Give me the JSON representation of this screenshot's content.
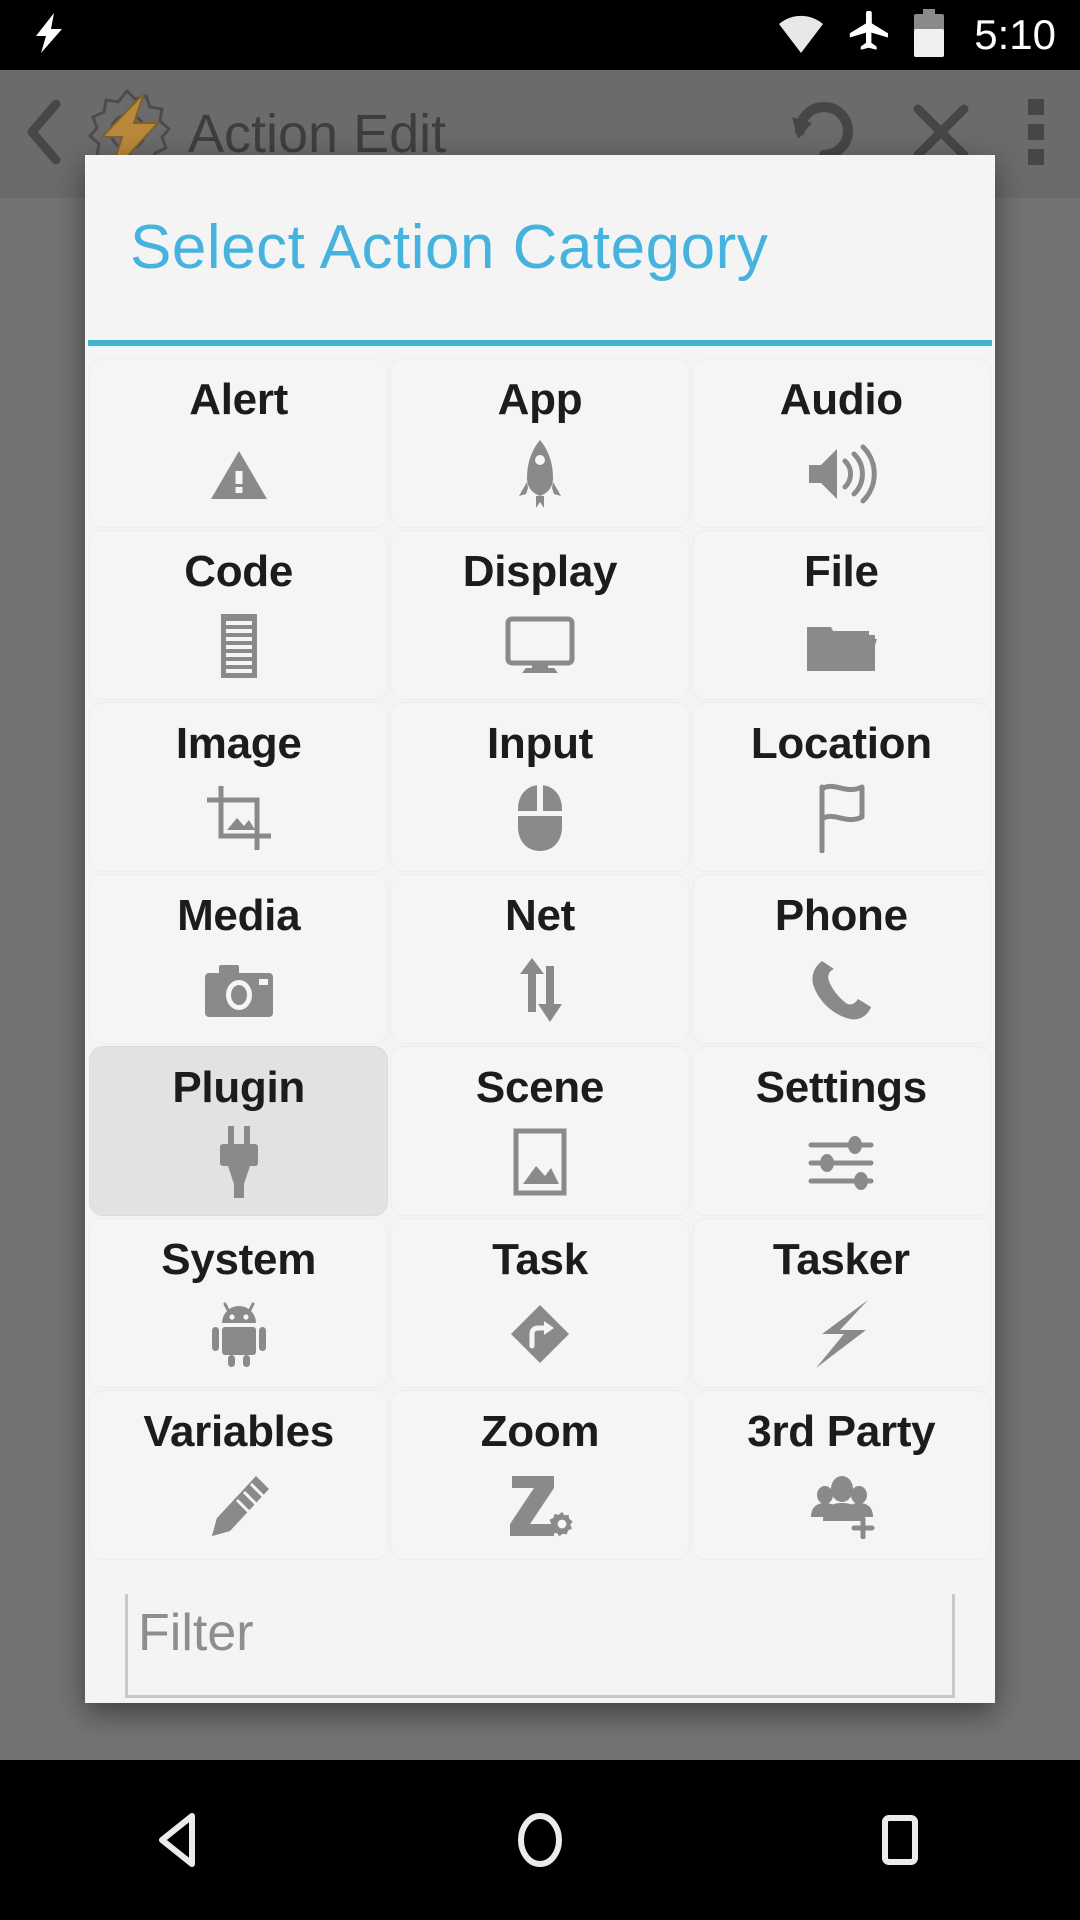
{
  "status_bar": {
    "time": "5:10",
    "icons": [
      "wifi-icon",
      "airplane-mode-icon",
      "battery-icon"
    ]
  },
  "background_app": {
    "title": "Action Edit",
    "back_icon": "back-chevron-icon",
    "logo_icon": "tasker-gear-logo-icon",
    "actions": [
      "undo-icon",
      "close-x-icon",
      "overflow-menu-icon"
    ]
  },
  "dialog": {
    "title": "Select Action Category",
    "accent_color": "#45b3dd",
    "divider_color": "#45b2cf",
    "background_color": "#f4f4f4",
    "selected_cell_color": "#e2e2e2",
    "categories": [
      {
        "label": "Alert",
        "icon": "warning-triangle-icon",
        "selected": false
      },
      {
        "label": "App",
        "icon": "rocket-icon",
        "selected": false
      },
      {
        "label": "Audio",
        "icon": "speaker-volume-icon",
        "selected": false
      },
      {
        "label": "Code",
        "icon": "lined-document-icon",
        "selected": false
      },
      {
        "label": "Display",
        "icon": "monitor-icon",
        "selected": false
      },
      {
        "label": "File",
        "icon": "folder-icon",
        "selected": false
      },
      {
        "label": "Image",
        "icon": "crop-image-icon",
        "selected": false
      },
      {
        "label": "Input",
        "icon": "mouse-icon",
        "selected": false
      },
      {
        "label": "Location",
        "icon": "flag-icon",
        "selected": false
      },
      {
        "label": "Media",
        "icon": "camera-icon",
        "selected": false
      },
      {
        "label": "Net",
        "icon": "up-down-arrows-icon",
        "selected": false
      },
      {
        "label": "Phone",
        "icon": "phone-handset-icon",
        "selected": false
      },
      {
        "label": "Plugin",
        "icon": "power-plug-icon",
        "selected": true
      },
      {
        "label": "Scene",
        "icon": "picture-frame-icon",
        "selected": false
      },
      {
        "label": "Settings",
        "icon": "sliders-icon",
        "selected": false
      },
      {
        "label": "System",
        "icon": "android-robot-icon",
        "selected": false
      },
      {
        "label": "Task",
        "icon": "diamond-arrow-icon",
        "selected": false
      },
      {
        "label": "Tasker",
        "icon": "lightning-bolt-icon",
        "selected": false
      },
      {
        "label": "Variables",
        "icon": "pencil-edit-icon",
        "selected": false
      },
      {
        "label": "Zoom",
        "icon": "z-gear-icon",
        "selected": false
      },
      {
        "label": "3rd Party",
        "icon": "add-people-icon",
        "selected": false
      }
    ],
    "filter": {
      "placeholder": "Filter",
      "value": ""
    }
  },
  "nav_bar": {
    "buttons": [
      "back-triangle-icon",
      "home-circle-icon",
      "recents-square-icon"
    ]
  }
}
